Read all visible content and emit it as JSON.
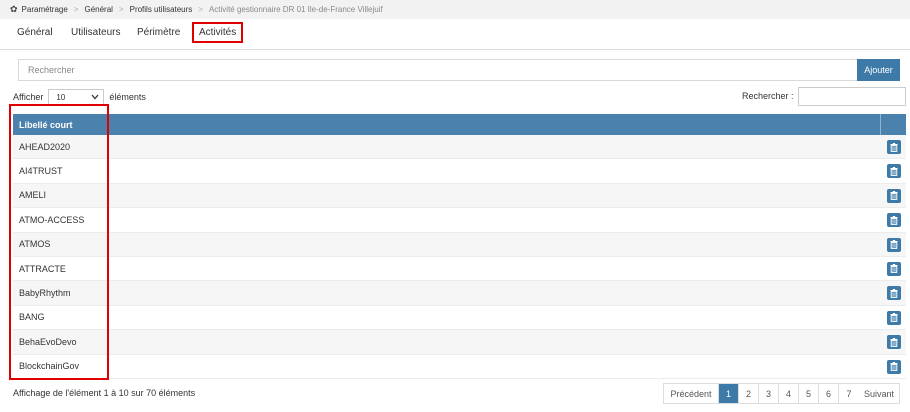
{
  "breadcrumb": {
    "items": [
      "Paramétrage",
      "Général",
      "Profils utilisateurs"
    ],
    "current": "Activité gestionnaire DR 01 Ile-de-France Villejuif"
  },
  "tabs": [
    "Général",
    "Utilisateurs",
    "Périmètre",
    "Activités"
  ],
  "search": {
    "placeholder": "Rechercher",
    "add_label": "Ajouter"
  },
  "length": {
    "prefix": "Afficher",
    "value": "10",
    "suffix": "éléments"
  },
  "filter_label": "Rechercher :",
  "table": {
    "header": "Libellé court",
    "rows": [
      "AHEAD2020",
      "AI4TRUST",
      "AMELI",
      "ATMO-ACCESS",
      "ATMOS",
      "ATTRACTE",
      "BabyRhythm",
      "BANG",
      "BehaEvoDevo",
      "BlockchainGov"
    ]
  },
  "info": "Affichage de l'élément 1 à  10 sur 70 éléments",
  "pagination": {
    "prev": "Précédent",
    "pages": [
      "1",
      "2",
      "3",
      "4",
      "5",
      "6",
      "7"
    ],
    "next": "Suivant",
    "active": "1"
  },
  "colors": {
    "accent": "#3d7aa8",
    "header": "#4a81ad",
    "highlight": "#e00000"
  }
}
